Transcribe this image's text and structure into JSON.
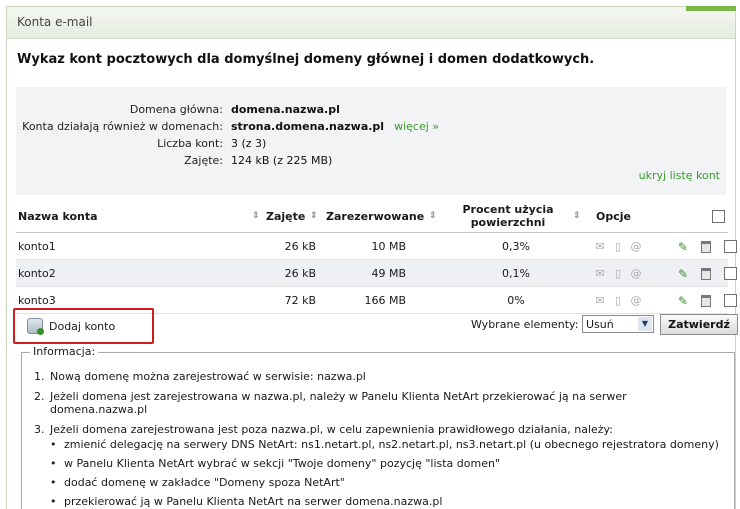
{
  "header": {
    "title": "Konta e-mail"
  },
  "intro": "Wykaz kont pocztowych dla domyślnej domeny głównej i domen dodatkowych.",
  "info": {
    "main_domain_label": "Domena główna:",
    "main_domain": "domena.nazwa.pl",
    "other_domains_label": "Konta działają również w domenach:",
    "other_domains": "strona.domena.nazwa.pl",
    "more_link": "więcej »",
    "count_label": "Liczba kont:",
    "count": "3 (z 3)",
    "used_label": "Zajęte:",
    "used": "124 kB (z 225 MB)",
    "hide_link": "ukryj listę kont"
  },
  "table": {
    "headers": {
      "name": "Nazwa konta",
      "used": "Zajęte",
      "reserved": "Zarezerwowane",
      "percent_line1": "Procent użycia",
      "percent_line2": "powierzchni",
      "options": "Opcje"
    },
    "rows": [
      {
        "name": "konto1",
        "used": "26 kB",
        "reserved": "10 MB",
        "percent": "0,3%"
      },
      {
        "name": "konto2",
        "used": "26 kB",
        "reserved": "49 MB",
        "percent": "0,1%"
      },
      {
        "name": "konto3",
        "used": "72 kB",
        "reserved": "166 MB",
        "percent": "0%"
      }
    ]
  },
  "actions": {
    "add_label": "Dodaj konto",
    "selected_label": "Wybrane elementy:",
    "selected_value": "Usuń",
    "submit_label": "Zatwierdź"
  },
  "information": {
    "legend": "Informacja:",
    "items": [
      "Nową domenę można zarejestrować w serwisie: nazwa.pl",
      "Jeżeli domena jest zarejestrowana w nazwa.pl, należy w Panelu Klienta NetArt przekierować ją na serwer domena.nazwa.pl",
      "Jeżeli domena zarejestrowana jest poza nazwa.pl, w celu zapewnienia prawidłowego działania, należy:"
    ],
    "subitems": [
      "zmienić delegację na serwery DNS NetArt: ns1.netart.pl, ns2.netart.pl, ns3.netart.pl (u obecnego rejestratora domeny)",
      "w Panelu Klienta NetArt wybrać w sekcji \"Twoje domeny\" pozycję \"lista domen\"",
      "dodać domenę w zakładce \"Domeny spoza NetArt\"",
      "przekierować ją w Panelu Klienta NetArt na serwer domena.nazwa.pl"
    ]
  },
  "colors": {
    "accent": "#7ab648",
    "link": "#3a9a2c",
    "highlight": "#d01c1c"
  }
}
